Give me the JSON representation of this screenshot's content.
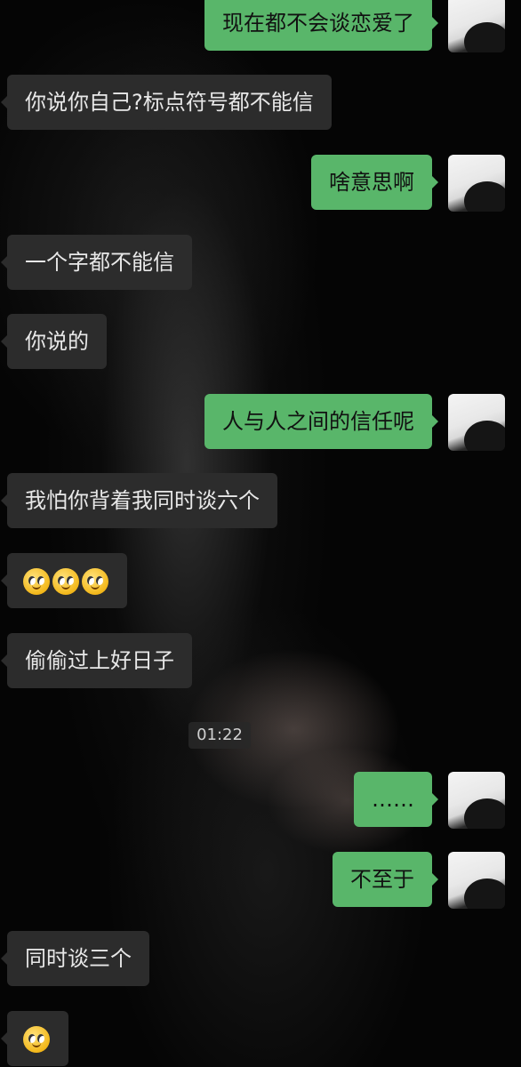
{
  "messages": [
    {
      "side": "out",
      "text": "现在都不会谈恋爱了"
    },
    {
      "side": "in",
      "text": "你说你自己?标点符号都不能信"
    },
    {
      "side": "out",
      "text": "啥意思啊"
    },
    {
      "side": "in",
      "text": "一个字都不能信"
    },
    {
      "side": "in",
      "text": "你说的"
    },
    {
      "side": "out",
      "text": "人与人之间的信任呢"
    },
    {
      "side": "in",
      "text": "我怕你背着我同时谈六个"
    },
    {
      "side": "in",
      "emoji": [
        "smiling-face-emoji",
        "smiling-face-emoji",
        "smiling-face-emoji"
      ]
    },
    {
      "side": "in",
      "text": "偷偷过上好日子"
    },
    {
      "side": "out",
      "text": "……"
    },
    {
      "side": "out",
      "text": "不至于"
    },
    {
      "side": "in",
      "text": "同时谈三个"
    },
    {
      "side": "in",
      "emoji": [
        "smiling-face-emoji"
      ]
    }
  ],
  "timestamp": "01:22",
  "colors": {
    "incoming_bubble": "#2c2c2c",
    "outgoing_bubble": "#59b66a",
    "background": "#050505"
  }
}
